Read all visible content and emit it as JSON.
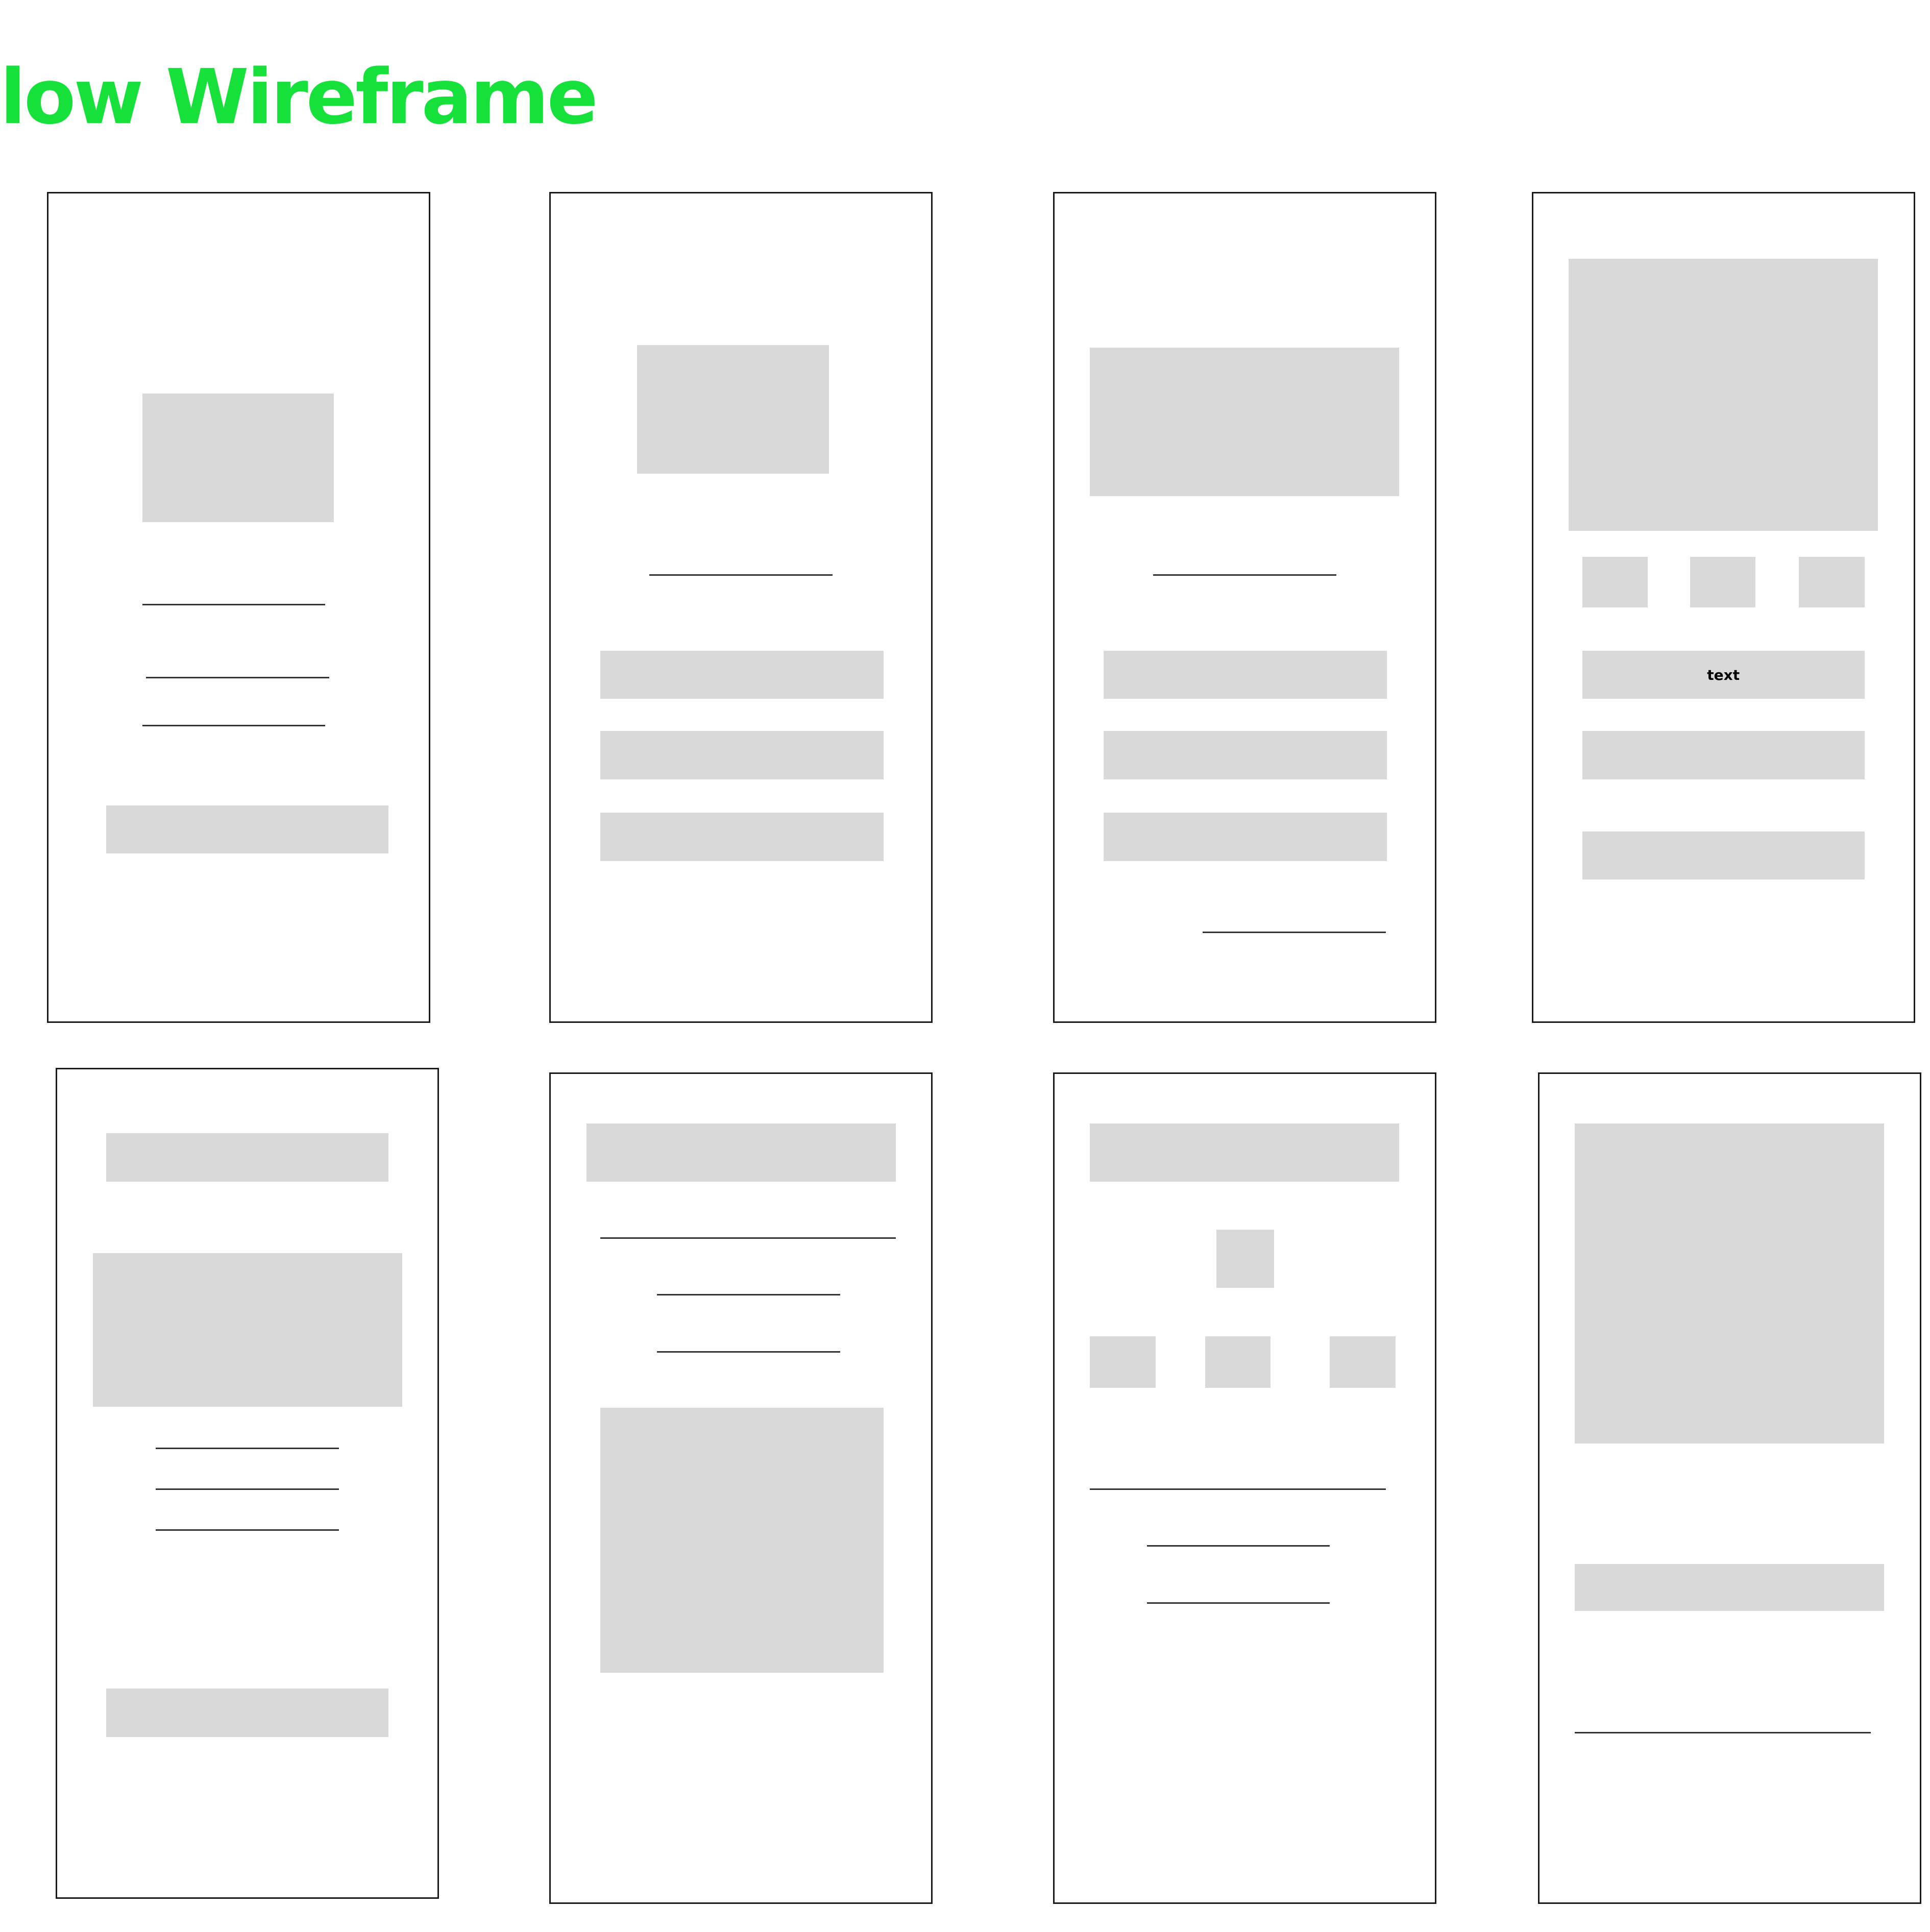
{
  "title": {
    "text": "low Wireframe",
    "color": "#16e03a"
  },
  "frames": [
    {
      "name": "frame-1"
    },
    {
      "name": "frame-2"
    },
    {
      "name": "frame-3"
    },
    {
      "name": "frame-4",
      "label": "text"
    },
    {
      "name": "frame-5"
    },
    {
      "name": "frame-6"
    },
    {
      "name": "frame-7"
    },
    {
      "name": "frame-8"
    }
  ],
  "colors": {
    "block": "#d9d9d9",
    "border": "#1a1a1a",
    "line": "#333333"
  }
}
